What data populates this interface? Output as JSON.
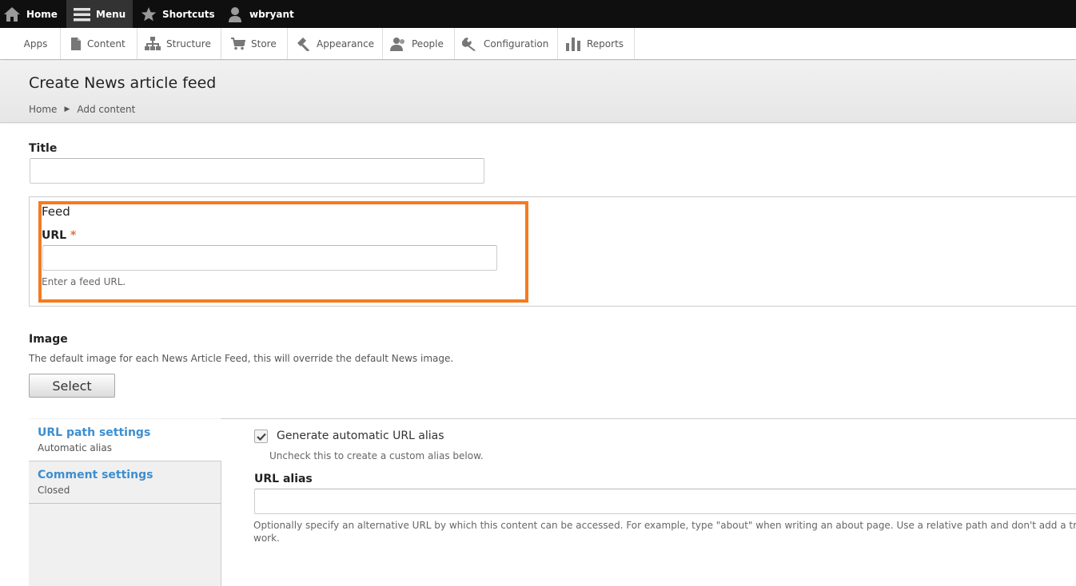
{
  "toolbar": {
    "home": "Home",
    "menu": "Menu",
    "shortcuts": "Shortcuts",
    "user": "wbryant"
  },
  "tray": {
    "items": [
      "Apps",
      "Content",
      "Structure",
      "Store",
      "Appearance",
      "People",
      "Configuration",
      "Reports"
    ]
  },
  "page": {
    "title": "Create News article feed",
    "breadcrumb": [
      "Home",
      "Add content"
    ]
  },
  "form": {
    "title_label": "Title",
    "title_value": "",
    "feed_legend": "Feed",
    "url_label": "URL",
    "url_required_mark": "*",
    "url_value": "",
    "url_help": "Enter a feed URL.",
    "image_label": "Image",
    "image_help": "The default image for each News Article Feed, this will override the default News image.",
    "select_button": "Select"
  },
  "vertical_tabs": {
    "tabs": [
      {
        "title": "URL path settings",
        "summary": "Automatic alias"
      },
      {
        "title": "Comment settings",
        "summary": "Closed"
      }
    ],
    "generate_alias_label": "Generate automatic URL alias",
    "generate_alias_checked": true,
    "generate_alias_help": "Uncheck this to create a custom alias below.",
    "url_alias_label": "URL alias",
    "url_alias_value": "",
    "url_alias_help": "Optionally specify an alternative URL by which this content can be accessed. For example, type \"about\" when writing an about page. Use a relative path and don't add a trailing sla",
    "url_alias_help_cont": "work."
  },
  "colors": {
    "toolbar_bg": "#0f0f0f",
    "highlight": "#f47b20",
    "link": "#3d8ecf",
    "required": "#e8712b"
  },
  "icons": [
    "home-icon",
    "menu-icon",
    "star-icon",
    "user-icon",
    "content-icon",
    "structure-icon",
    "cart-icon",
    "appearance-icon",
    "people-icon",
    "wrench-icon",
    "reports-icon",
    "check-icon"
  ]
}
